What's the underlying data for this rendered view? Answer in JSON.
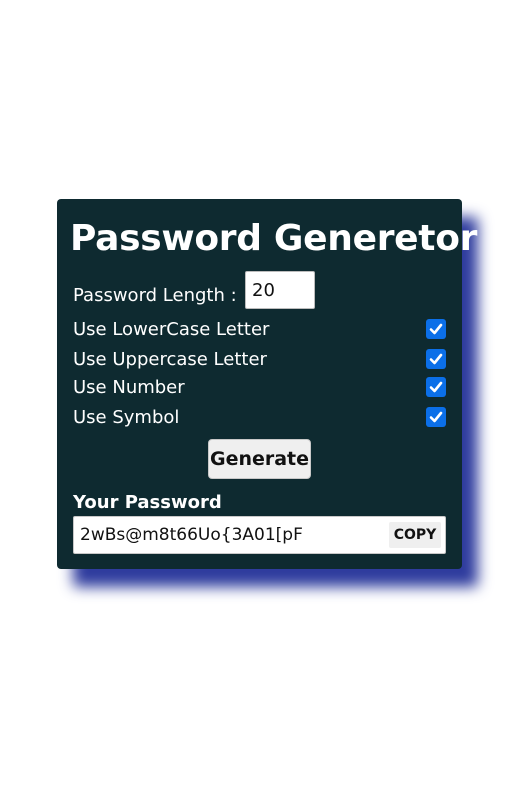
{
  "app": {
    "title": "Password Generetor"
  },
  "form": {
    "length_label": "Password Length :",
    "length_value": "20",
    "options": [
      {
        "label": "Use LowerCase Letter",
        "checked": true
      },
      {
        "label": "Use Uppercase Letter",
        "checked": true
      },
      {
        "label": "Use Number",
        "checked": true
      },
      {
        "label": "Use Symbol",
        "checked": true
      }
    ],
    "generate_label": "Generate"
  },
  "output": {
    "label": "Your Password",
    "value": "2wBs@m8t66Uo{3A01[pF",
    "copy_label": "COPY"
  },
  "colors": {
    "card_background": "#0e2a30",
    "card_shadow": "#2f3c9e",
    "checkbox_accent": "#0b6fe8"
  },
  "icons": {
    "checkbox": "checkmark-icon"
  }
}
